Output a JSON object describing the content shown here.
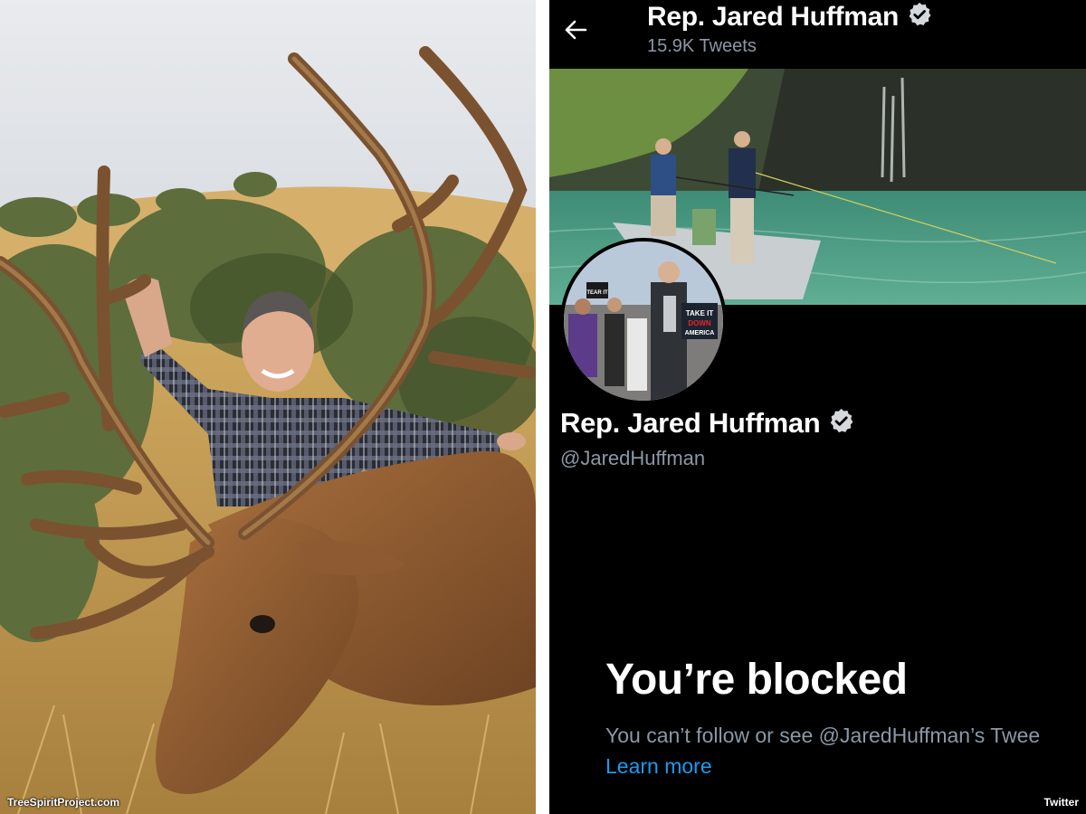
{
  "left_image": {
    "description_icon": "hunter-with-elk-photo",
    "credit": "TreeSpiritProject.com"
  },
  "twitter": {
    "header": {
      "name": "Rep. Jared Huffman",
      "tweet_count": "15.9K Tweets",
      "back_icon": "back-arrow-icon",
      "verified_icon": "verified-badge-icon"
    },
    "banner": {
      "sign_1": "TAKE IT",
      "sign_2": "DOWN",
      "sign_3": "AMERICA"
    },
    "profile": {
      "name": "Rep. Jared Huffman",
      "handle": "@JaredHuffman"
    },
    "blocked": {
      "title": "You’re blocked",
      "description": "You can’t follow or see @JaredHuffman’s Twee",
      "link": "Learn more"
    },
    "credit": "Twitter"
  },
  "colors": {
    "link": "#1d9bf0",
    "muted": "#8b98a5",
    "background": "#000000"
  }
}
